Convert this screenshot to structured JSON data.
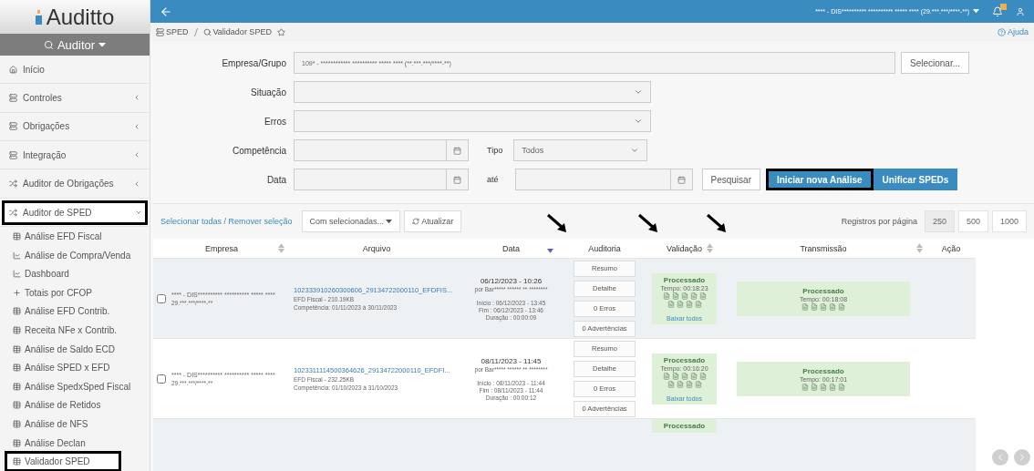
{
  "brand": {
    "name": "Auditto"
  },
  "sidebar": {
    "profile": "Auditor",
    "items": [
      {
        "label": "Início",
        "kind": "home",
        "highlighted": false
      },
      {
        "label": "Controles",
        "kind": "list",
        "expanded": false,
        "highlighted": false
      },
      {
        "label": "Obrigações",
        "kind": "list",
        "expanded": false,
        "highlighted": false
      },
      {
        "label": "Integração",
        "kind": "list",
        "expanded": false,
        "highlighted": false
      },
      {
        "label": "Auditor de Obrigações",
        "kind": "shuffle",
        "expanded": false,
        "highlighted": false
      },
      {
        "label": "Auditor de SPED",
        "kind": "shuffle",
        "expanded": true,
        "highlighted": true,
        "children": [
          {
            "label": "Análise EFD Fiscal",
            "kind": "table",
            "highlighted": false
          },
          {
            "label": "Análise de Compra/Venda",
            "kind": "chart",
            "highlighted": false
          },
          {
            "label": "Dashboard",
            "kind": "chart",
            "highlighted": false
          },
          {
            "label": "Totais por CFOP",
            "kind": "plus",
            "highlighted": false
          },
          {
            "label": "Análise EFD Contrib.",
            "kind": "table",
            "highlighted": false
          },
          {
            "label": "Receita NFe x Contrib.",
            "kind": "table",
            "highlighted": false
          },
          {
            "label": "Análise de Saldo ECD",
            "kind": "table",
            "highlighted": false
          },
          {
            "label": "Análise SPED x EFD",
            "kind": "table",
            "highlighted": false
          },
          {
            "label": "Análise SpedxSped Fiscal",
            "kind": "table",
            "highlighted": false
          },
          {
            "label": "Análise de Retidos",
            "kind": "table",
            "highlighted": false
          },
          {
            "label": "Análise de NFS",
            "kind": "table",
            "highlighted": false
          },
          {
            "label": "Análise Declan",
            "kind": "table",
            "highlighted": false
          },
          {
            "label": "Validador SPED",
            "kind": "table",
            "highlighted": true
          }
        ]
      }
    ]
  },
  "topbar": {
    "company": "**** - DIS********** ********** ***** **** (29.***.***/****-**)"
  },
  "breadcrumb": [
    {
      "label": "SPED",
      "kind": "list"
    },
    {
      "label": "Validador SPED",
      "kind": "search"
    }
  ],
  "help": "Ajuda",
  "form": {
    "empresa_label": "Empresa/Grupo",
    "empresa_value": "109* - ************ ********** ***** **** (**.***.***/****-**)",
    "select_button": "Selecionar...",
    "situacao_label": "Situação",
    "erros_label": "Erros",
    "competencia_label": "Competência",
    "tipo_label": "Tipo",
    "tipo_value": "Todos",
    "data_label": "Data",
    "ate_label": "até",
    "buttons": [
      {
        "label": "Pesquisar",
        "kind": "default",
        "highlighted": false
      },
      {
        "label": "Iniciar nova Análise",
        "kind": "primary",
        "highlighted": true
      },
      {
        "label": "Unificar SPEDs",
        "kind": "primary",
        "highlighted": false
      }
    ]
  },
  "toolbar": {
    "select_link": "Selecionar todas / Remover seleção",
    "with_selected": "Com selecionadas...",
    "refresh": "Atualizar",
    "per_page_label": "Registros por página",
    "per_page": [
      {
        "label": "250",
        "selected": true
      },
      {
        "label": "500",
        "selected": false
      },
      {
        "label": "1000",
        "selected": false
      }
    ]
  },
  "table": {
    "columns": [
      {
        "label": "Empresa",
        "sortable": true,
        "sorted": false,
        "annotated": false
      },
      {
        "label": "Arquivo",
        "sortable": false,
        "annotated": false
      },
      {
        "label": "Data",
        "sortable": true,
        "sorted": true,
        "annotated": false
      },
      {
        "label": "Auditoria",
        "sortable": false,
        "annotated": true
      },
      {
        "label": "Validação",
        "sortable": true,
        "sorted": false,
        "annotated": true
      },
      {
        "label": "Transmissão",
        "sortable": true,
        "sorted": false,
        "annotated": true
      },
      {
        "label": "Ação",
        "sortable": false,
        "annotated": false
      }
    ],
    "rows": [
      {
        "checked": false,
        "company": "**** - DIS********** ********** ***** ****",
        "cnpj": "29.***.***/****-**",
        "file": "102333910260300606_29134722000110_EFDFIS...",
        "file_info": "EFD Fiscal - 210.19KB",
        "period": "Competência: 01/11/2023 à 30/11/2023",
        "date": "06/12/2023 - 10:26",
        "by": "por Bar***** ****** ** ********",
        "start": "Início : 06/12/2023 - 13:45",
        "end": "Fim : 06/12/2023 - 13:46",
        "duration": "Duração : 00:00:09",
        "audit_buttons": [
          "Resumo",
          "Detalhe",
          "0 Erros",
          "0 Advertências"
        ],
        "validation": {
          "status": "Processado",
          "time": "Tempo: 00:18:23",
          "download": "Baixar todos"
        },
        "transmission": {
          "status": "Processado",
          "time": "Tempo: 00:18:08"
        }
      },
      {
        "checked": false,
        "company": "**** - DIS********** ********** ***** ****",
        "cnpj": "29.***.***/****-**",
        "file": "1023311114500364626_29134722000110_EFDFI...",
        "file_info": "EFD Fiscal - 232.25KB",
        "period": "Competência: 01/10/2023 à 31/10/2023",
        "date": "08/11/2023 - 11:45",
        "by": "por Bar***** ****** ** ********",
        "start": "Início : 08/11/2023 - 11:44",
        "end": "Fim : 08/11/2023 - 11:44",
        "duration": "Duração : 00:00:12",
        "audit_buttons": [
          "Resumo",
          "Detalhe",
          "0 Erros",
          "0 Advertências"
        ],
        "validation": {
          "status": "Processado",
          "time": "Tempo: 00:16:20",
          "download": "Baixar todos"
        },
        "transmission": {
          "status": "Processado",
          "time": "Tempo: 00:17:01"
        }
      },
      {
        "validation": {
          "status": "Processado"
        }
      }
    ]
  }
}
